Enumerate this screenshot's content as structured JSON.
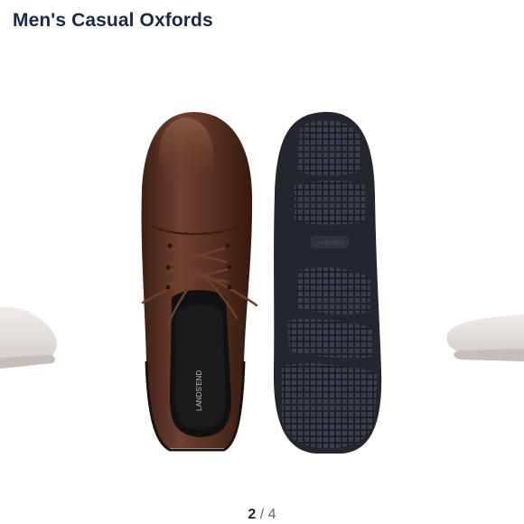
{
  "product": {
    "title": "Men's Casual Oxfords"
  },
  "gallery": {
    "current_page": "2",
    "separator": "/",
    "total_pages": "4",
    "image_text": {
      "insole_brand": "LANDS'END",
      "outsole_brand": "LANDS'END"
    }
  },
  "colors": {
    "title": "#1d2a44",
    "leather": "#5a3324",
    "sole": "#24262d"
  }
}
